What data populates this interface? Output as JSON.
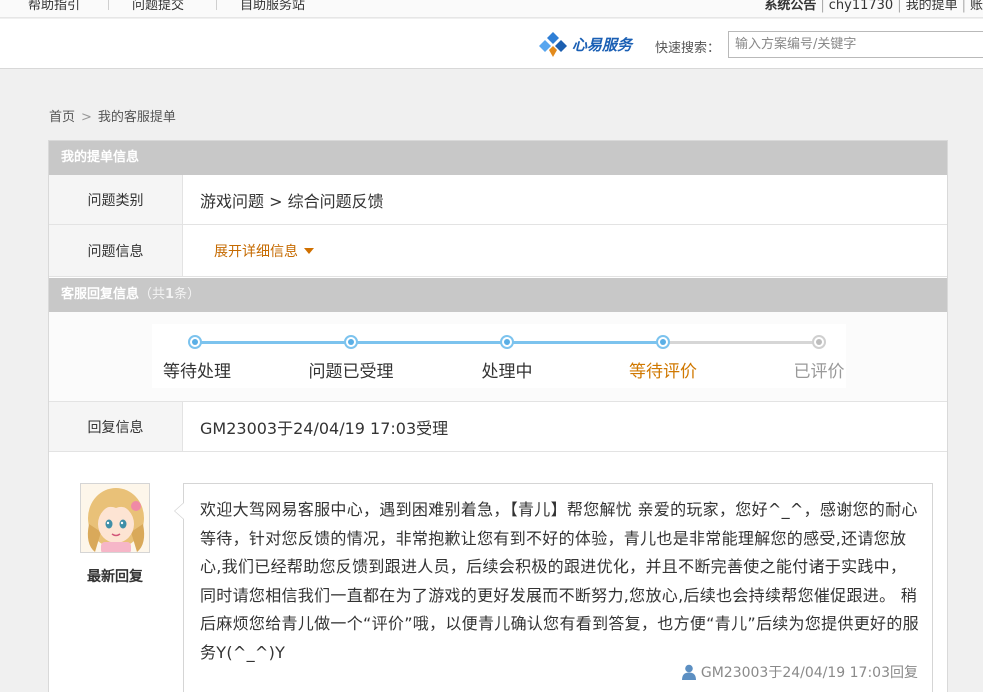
{
  "top_nav": {
    "items": [
      "帮助指引",
      "问题提交",
      "自助服务站"
    ],
    "announcement": "系统公告",
    "username": "chy11730",
    "my_tickets": "我的提单",
    "more": "账"
  },
  "header": {
    "logo_text": "心易服务",
    "search_label": "快速搜索：",
    "search_placeholder": "输入方案编号/关键字"
  },
  "breadcrumb": {
    "home": "首页",
    "arrow": ">",
    "current": "我的客服提单"
  },
  "ticket_info": {
    "section_title": "我的提单信息",
    "category_label": "问题类别",
    "category_value": "游戏问题 > 综合问题反馈",
    "detail_label": "问题信息",
    "expand_link": "展开详细信息"
  },
  "reply_info": {
    "section_title": "客服回复信息",
    "count_prefix": "（共",
    "count": "1",
    "count_suffix": "条）",
    "progress_steps": [
      "等待处理",
      "问题已受理",
      "处理中",
      "等待评价",
      "已评价"
    ],
    "completed_steps": 4,
    "current_step": 4,
    "reply_label": "回复信息",
    "reply_value": "GM23003于24/04/19 17:03受理",
    "avatar_caption": "最新回复",
    "message": "欢迎大驾网易客服中心，遇到困难别着急，【青儿】帮您解忧    亲爱的玩家，您好^_^，感谢您的耐心等待，针对您反馈的情况，非常抱歉让您有到不好的体验，青儿也是非常能理解您的感受,还请您放心,我们已经帮助您反馈到跟进人员，后续会积极的跟进优化，并且不断完善使之能付诸于实践中，同时请您相信我们一直都在为了游戏的更好发展而不断努力,您放心,后续也会持续帮您催促跟进。      稍后麻烦您给青儿做一个“评价”哦，以便青儿确认您有看到答复，也方便“青儿”后续为您提供更好的服务Y(^_^)Y",
    "footer": "GM23003于24/04/19 17:03回复"
  },
  "colors": {
    "section_header_bg": "#c8c8c8",
    "progress_done": "#5aafe6",
    "progress_current_text": "#d07800",
    "link_orange": "#c56a00"
  }
}
